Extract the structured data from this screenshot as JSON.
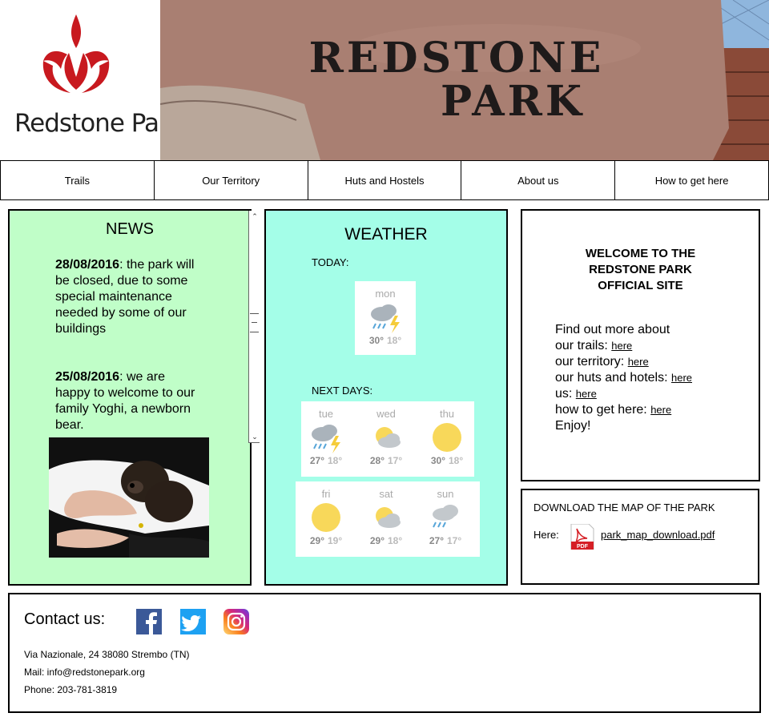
{
  "brand": {
    "logo_text": "Redstone Park",
    "logo_color": "#c8191f",
    "banner_line1": "REDSTONE",
    "banner_line2": "PARK"
  },
  "nav": {
    "items": [
      "Trails",
      "Our Territory",
      "Huts and Hostels",
      "About us",
      "How to get here"
    ]
  },
  "news": {
    "title": "NEWS",
    "items": [
      {
        "date": "28/08/2016",
        "text": ": the park will be closed, due to some special maintenance needed by some of our buildings"
      },
      {
        "date": "25/08/2016",
        "text": ": we are happy to welcome to our family Yoghi, a newborn bear."
      }
    ],
    "panel_color": "#c0fec8"
  },
  "weather": {
    "title": "WEATHER",
    "today_label": "TODAY:",
    "next_label": "NEXT DAYS:",
    "today": {
      "day": "mon",
      "hi": "30°",
      "lo": "18°",
      "icon": "storm-icon"
    },
    "next": [
      {
        "day": "tue",
        "hi": "27°",
        "lo": "18°",
        "icon": "storm-icon"
      },
      {
        "day": "wed",
        "hi": "28°",
        "lo": "17°",
        "icon": "partly-cloudy-icon"
      },
      {
        "day": "thu",
        "hi": "30°",
        "lo": "18°",
        "icon": "sun-icon"
      },
      {
        "day": "fri",
        "hi": "29°",
        "lo": "19°",
        "icon": "sun-icon"
      },
      {
        "day": "sat",
        "hi": "29°",
        "lo": "18°",
        "icon": "partly-cloudy-icon"
      },
      {
        "day": "sun",
        "hi": "27°",
        "lo": "17°",
        "icon": "rain-icon"
      }
    ],
    "panel_color": "#a4fee8"
  },
  "welcome": {
    "title_line1": "WELCOME TO THE",
    "title_line2": "REDSTONE PARK",
    "title_line3": "OFFICIAL SITE",
    "intro": "Find out more about",
    "rows": [
      {
        "text": "our trails: ",
        "link": "here"
      },
      {
        "text": "our territory: ",
        "link": "here"
      },
      {
        "text": "our huts and hotels: ",
        "link": "here"
      },
      {
        "text": "us: ",
        "link": "here"
      },
      {
        "text": "how to get here: ",
        "link": "here"
      }
    ],
    "outro": "Enjoy!"
  },
  "download": {
    "title": "DOWNLOAD THE MAP OF THE PARK",
    "here_label": "Here:",
    "file_name": "park_map_download.pdf",
    "pdf_badge": "PDF"
  },
  "contact": {
    "title": "Contact us:",
    "social": [
      "facebook-icon",
      "twitter-icon",
      "instagram-icon"
    ],
    "address": "Via Nazionale, 24 38080 Strembo (TN)",
    "mail": "Mail: info@redstonepark.org",
    "phone": "Phone: 203-781-3819"
  }
}
